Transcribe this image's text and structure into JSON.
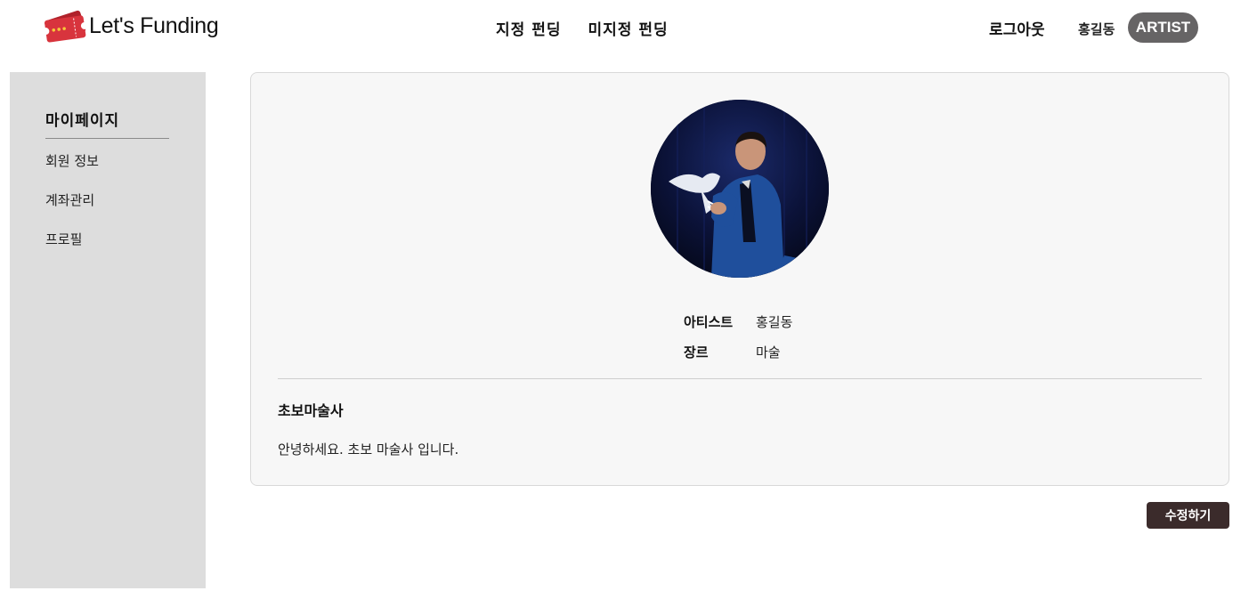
{
  "header": {
    "logo_text": "Let's Funding",
    "nav": [
      "지정 펀딩",
      "미지정 펀딩"
    ],
    "logout_label": "로그아웃",
    "username": "홍길동",
    "role_badge": "ARTIST"
  },
  "sidebar": {
    "title": "마이페이지",
    "items": [
      {
        "label": "회원 정보"
      },
      {
        "label": "계좌관리"
      },
      {
        "label": "프로필"
      }
    ]
  },
  "profile": {
    "fields": [
      {
        "label": "아티스트",
        "value": "홍길동"
      },
      {
        "label": "장르",
        "value": "마술"
      }
    ],
    "title": "초보마술사",
    "intro": "안녕하세요. 초보 마술사 입니다."
  },
  "actions": {
    "edit_label": "수정하기"
  },
  "colors": {
    "logo_ticket": "#d8343d",
    "role_badge_bg": "#666465",
    "sidebar_bg": "#dddddd",
    "card_bg": "#f7f7f7",
    "edit_button_bg": "#3b2b2b"
  }
}
